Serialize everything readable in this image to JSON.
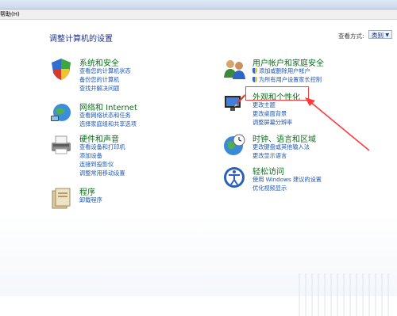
{
  "menubar": {
    "help": "帮助(H)"
  },
  "page": {
    "title": "调整计算机的设置",
    "viewby_label": "查看方式:",
    "viewby_value": "类别"
  },
  "categories": [
    {
      "title": "系统和安全",
      "links": [
        "查看您的计算机状态",
        "备份您的计算机",
        "查找并解决问题"
      ]
    },
    {
      "title": "网络和 Internet",
      "links": [
        "查看网络状态和任务",
        "选择家庭组和共享选项"
      ]
    },
    {
      "title": "硬件和声音",
      "links": [
        "查看设备和打印机",
        "添加设备",
        "连接到投影仪",
        "调整常用移动设置"
      ]
    },
    {
      "title": "程序",
      "links": [
        "卸载程序"
      ]
    },
    {
      "title": "用户帐户和家庭安全",
      "links": [
        "添加或删除用户帐户",
        "为所有用户设置家长控制"
      ]
    },
    {
      "title": "外观和个性化",
      "links": [
        "更改主题",
        "更改桌面背景",
        "调整屏幕分辨率"
      ]
    },
    {
      "title": "时钟、语言和区域",
      "links": [
        "更改键盘或其他输入法",
        "更改显示语言"
      ]
    },
    {
      "title": "轻松访问",
      "links": [
        "使用 Windows 建议的设置",
        "优化视频显示"
      ]
    }
  ],
  "colors": {
    "category_title": "#0f6e1f",
    "link": "#1e57b4",
    "annotation": "#ff3b3b"
  }
}
